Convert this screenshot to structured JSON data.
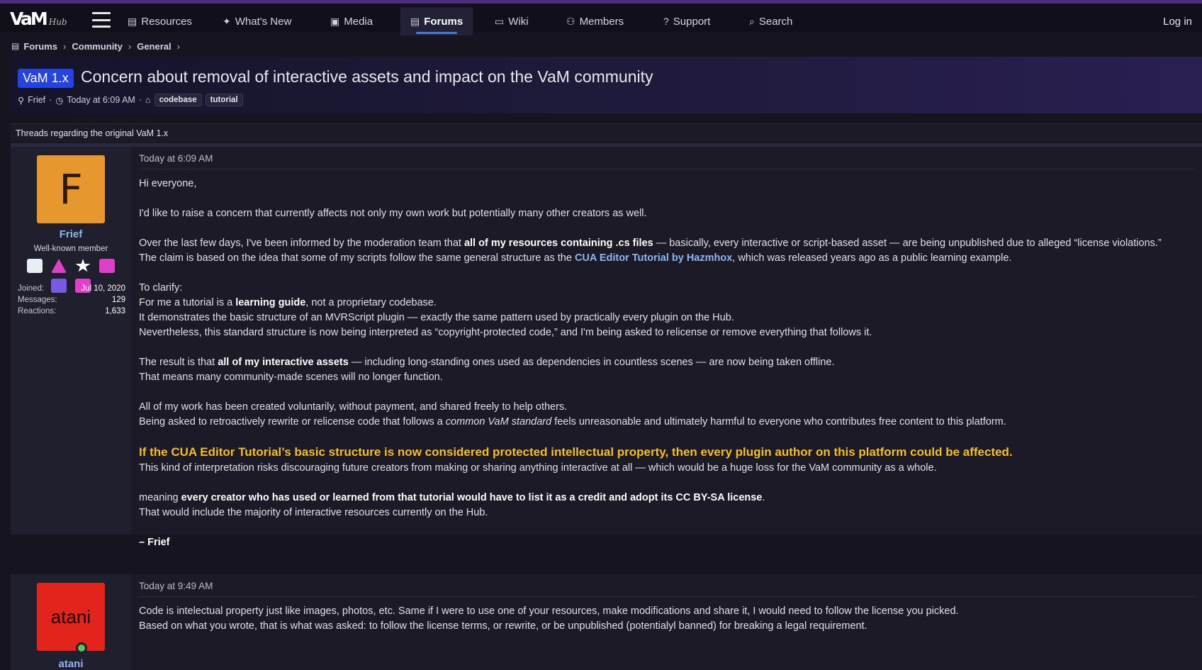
{
  "nav": {
    "logo_main": "VaM",
    "logo_sub": "Hub",
    "items": [
      {
        "label": "Resources",
        "icon": "document-icon",
        "glyph": "▤"
      },
      {
        "label": "What's New",
        "icon": "sparkle-icon",
        "glyph": "✦"
      },
      {
        "label": "Media",
        "icon": "image-icon",
        "glyph": "▣"
      },
      {
        "label": "Forums",
        "icon": "forum-icon",
        "glyph": "▤",
        "active": true
      },
      {
        "label": "Wiki",
        "icon": "book-icon",
        "glyph": "▭"
      },
      {
        "label": "Members",
        "icon": "users-icon",
        "glyph": "⚇"
      },
      {
        "label": "Support",
        "icon": "help-icon",
        "glyph": "?"
      },
      {
        "label": "Search",
        "icon": "search-icon",
        "glyph": "⌕"
      }
    ],
    "login": "Log in"
  },
  "breadcrumb": [
    "Forums",
    "Community",
    "General"
  ],
  "thread": {
    "prefix": "VaM 1.x",
    "title": "Concern about removal of interactive assets and impact on the VaM community",
    "author": "Frief",
    "time": "Today at 6:09 AM",
    "tags": [
      "codebase",
      "tutorial"
    ]
  },
  "forum_description": "Threads regarding the original VaM 1.x",
  "posts": [
    {
      "avatar_letter": "F",
      "avatar_color": "#e6982e",
      "username": "Frief",
      "usertitle": "Well-known member",
      "stats": [
        {
          "label": "Joined:",
          "value": "Jul 10, 2020"
        },
        {
          "label": "Messages:",
          "value": "129"
        },
        {
          "label": "Reactions:",
          "value": "1,633"
        }
      ],
      "date": "Today at 6:09 AM",
      "p1": "Hi everyone,",
      "p2": "I'd like to raise a concern that currently affects not only my own work but potentially many other creators as well.",
      "p3a": "Over the last few days, I've been informed by the moderation team that ",
      "p3b": "all of my resources containing .cs files",
      "p3c": " — basically, every interactive or script-based asset — are being unpublished due to alleged “license violations.”",
      "p3d": "The claim is based on the idea that some of my scripts follow the same general structure as the ",
      "p3e": "CUA Editor Tutorial by Hazmhox",
      "p3f": ", which was released years ago as a public learning example.",
      "p4a": "To clarify:",
      "p4b": "For me a tutorial is a ",
      "p4c": "learning guide",
      "p4d": ", not a proprietary codebase.",
      "p4e": "It demonstrates the basic structure of an MVRScript plugin — exactly the same pattern used by practically every plugin on the Hub.",
      "p4f": "Nevertheless, this standard structure is now being interpreted as “copyright-protected code,” and I'm being asked to relicense or remove everything that follows it.",
      "p5a": "The result is that ",
      "p5b": "all of my interactive assets",
      "p5c": " — including long-standing ones used as dependencies in countless scenes — are now being taken offline.",
      "p5d": "That means many community-made scenes will no longer function.",
      "p6a": "All of my work has been created voluntarily, without payment, and shared freely to help others.",
      "p6b": "Being asked to retroactively rewrite or relicense code that follows a ",
      "p6c": "common VaM standard",
      "p6d": " feels unreasonable and ultimately harmful to everyone who contributes free content to this platform.",
      "p7a": "If the CUA Editor Tutorial’s basic structure is now considered protected intellectual property, then every plugin author on this platform could be affected.",
      "p7b": "This kind of interpretation risks discouraging future creators from making or sharing anything interactive at all — which would be a huge loss for the VaM community as a whole.",
      "p8a": "meaning ",
      "p8b": "every creator who has used or learned from that tutorial would have to list it as a credit and adopt its CC BY-SA license",
      "p8c": ".",
      "p8d": "That would include the majority of interactive resources currently on the Hub.",
      "sig": "– Frief"
    },
    {
      "avatar_text": "atani",
      "avatar_color": "#e3241c",
      "username": "atani",
      "date": "Today at 9:49 AM",
      "p1": "Code is intelectual property just like images, photos, etc. Same if I were to use one of your resources, make modifications and share it, I would need to follow the license you picked.",
      "p2": "Based on what you wrote, that is what was asked: to follow the license terms, or rewrite, or be unpublished (potentialyl banned) for breaking a legal requirement."
    }
  ]
}
